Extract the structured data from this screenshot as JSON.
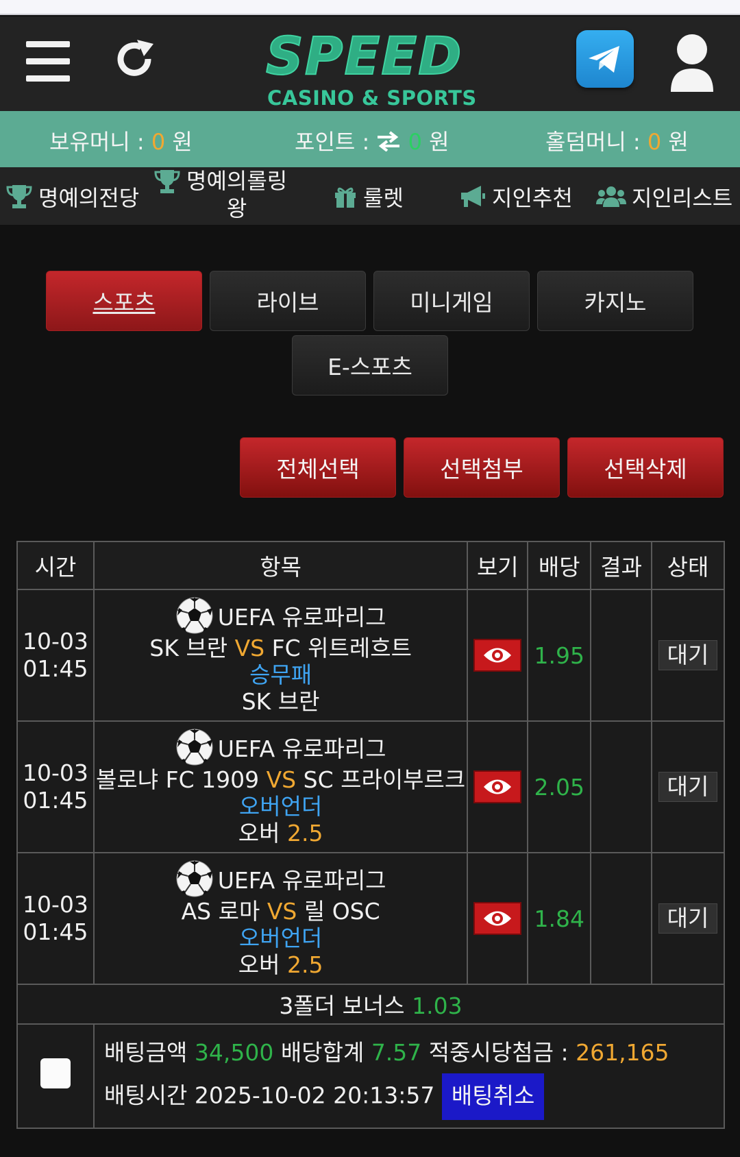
{
  "header": {
    "logo_main": "SPEED",
    "logo_sub": "CASINO & SPORTS"
  },
  "money": {
    "holding_label": "보유머니 :",
    "holding_value": "0",
    "holding_unit": "원",
    "point_label": "포인트 :",
    "point_value": "0",
    "point_unit": "원",
    "holdem_label": "홀덤머니 :",
    "holdem_value": "0",
    "holdem_unit": "원"
  },
  "nav": {
    "hall_of_fame": "명예의전당",
    "rolling_king_1": "명예의롤링",
    "rolling_king_2": "왕",
    "roulette": "룰렛",
    "referral": "지인추천",
    "referral_list": "지인리스트"
  },
  "tabs": {
    "sports": "스포츠",
    "live": "라이브",
    "minigame": "미니게임",
    "casino": "카지노",
    "esports": "E-스포츠"
  },
  "actions": {
    "select_all": "전체선택",
    "attach_selected": "선택첨부",
    "delete_selected": "선택삭제"
  },
  "table": {
    "headers": [
      "시간",
      "항목",
      "보기",
      "배당",
      "결과",
      "상태"
    ],
    "rows": [
      {
        "date": "10-03",
        "time": "01:45",
        "league": "UEFA 유로파리그",
        "home": "SK 브란",
        "vs": "VS",
        "away": "FC 위트레흐트",
        "market": "승무패",
        "pick_text": "SK 브란",
        "pick_line": "",
        "odds": "1.95",
        "result": "",
        "status": "대기"
      },
      {
        "date": "10-03",
        "time": "01:45",
        "league": "UEFA 유로파리그",
        "home": "볼로냐 FC 1909",
        "vs": "VS",
        "away": "SC 프라이부르크",
        "market": "오버언더",
        "pick_text": "오버",
        "pick_line": "2.5",
        "odds": "2.05",
        "result": "",
        "status": "대기"
      },
      {
        "date": "10-03",
        "time": "01:45",
        "league": "UEFA 유로파리그",
        "home": "AS 로마",
        "vs": "VS",
        "away": "릴 OSC",
        "market": "오버언더",
        "pick_text": "오버",
        "pick_line": "2.5",
        "odds": "1.84",
        "result": "",
        "status": "대기"
      }
    ],
    "bonus_label": "3폴더 보너스",
    "bonus_value": "1.03"
  },
  "summary": {
    "bet_amount_label": "배팅금액",
    "bet_amount": "34,500",
    "odds_total_label": "배당합계",
    "odds_total": "7.57",
    "payout_label": "적중시당첨금 :",
    "payout": "261,165",
    "bet_time_label": "배팅시간",
    "bet_time": "2025-10-02 20:13:57",
    "cancel_label": "배팅취소"
  },
  "colors": {
    "money_bar": "#5cab93",
    "accent_red": "#c4272b",
    "odds_green": "#2fb34a",
    "highlight_orange": "#f0a832",
    "market_blue": "#3fa4f2",
    "cancel_blue": "#1b19c8"
  }
}
